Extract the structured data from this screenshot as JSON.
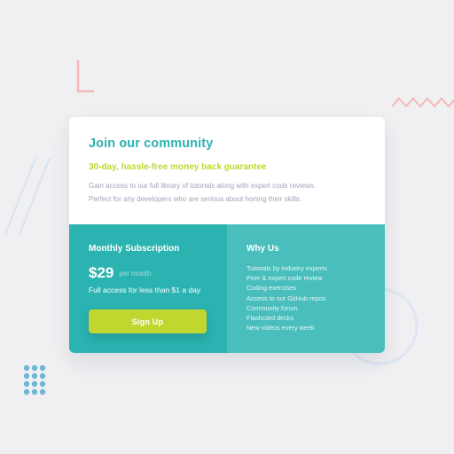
{
  "colors": {
    "background": "#f0f0f2",
    "teal": "#2bb3b1",
    "teal_light": "#4abebd",
    "lime": "#c1d72f",
    "muted_text": "#a0a5b8",
    "deco_pink": "#f5b6b6",
    "deco_blue": "#6fb6d3",
    "deco_line": "#d6e3f0"
  },
  "icons": [
    "l-shape-decoration-icon",
    "zigzag-decoration-icon",
    "diagonal-lines-decoration-icon",
    "dot-grid-decoration-icon",
    "circle-outline-decoration-icon"
  ],
  "card": {
    "title": "Join our community",
    "guarantee": "30-day, hassle-free money back guarantee",
    "description_line1": "Gain access to our full library of tutorials along with expert code reviews.",
    "description_line2": "Perfect for any developers who are serious about honing their skills.",
    "subscription": {
      "heading": "Monthly Subscription",
      "price": "$29",
      "period": "per month",
      "access_note": "Full access for less than $1 a day",
      "button_label": "Sign Up"
    },
    "why_us": {
      "heading": "Why Us",
      "items": [
        "Tutorials by industry experts",
        "Peer & expert code review",
        "Coding exercises",
        "Access to our GitHub repos",
        "Community forum",
        "Flashcard decks",
        "New videos every week"
      ]
    }
  }
}
